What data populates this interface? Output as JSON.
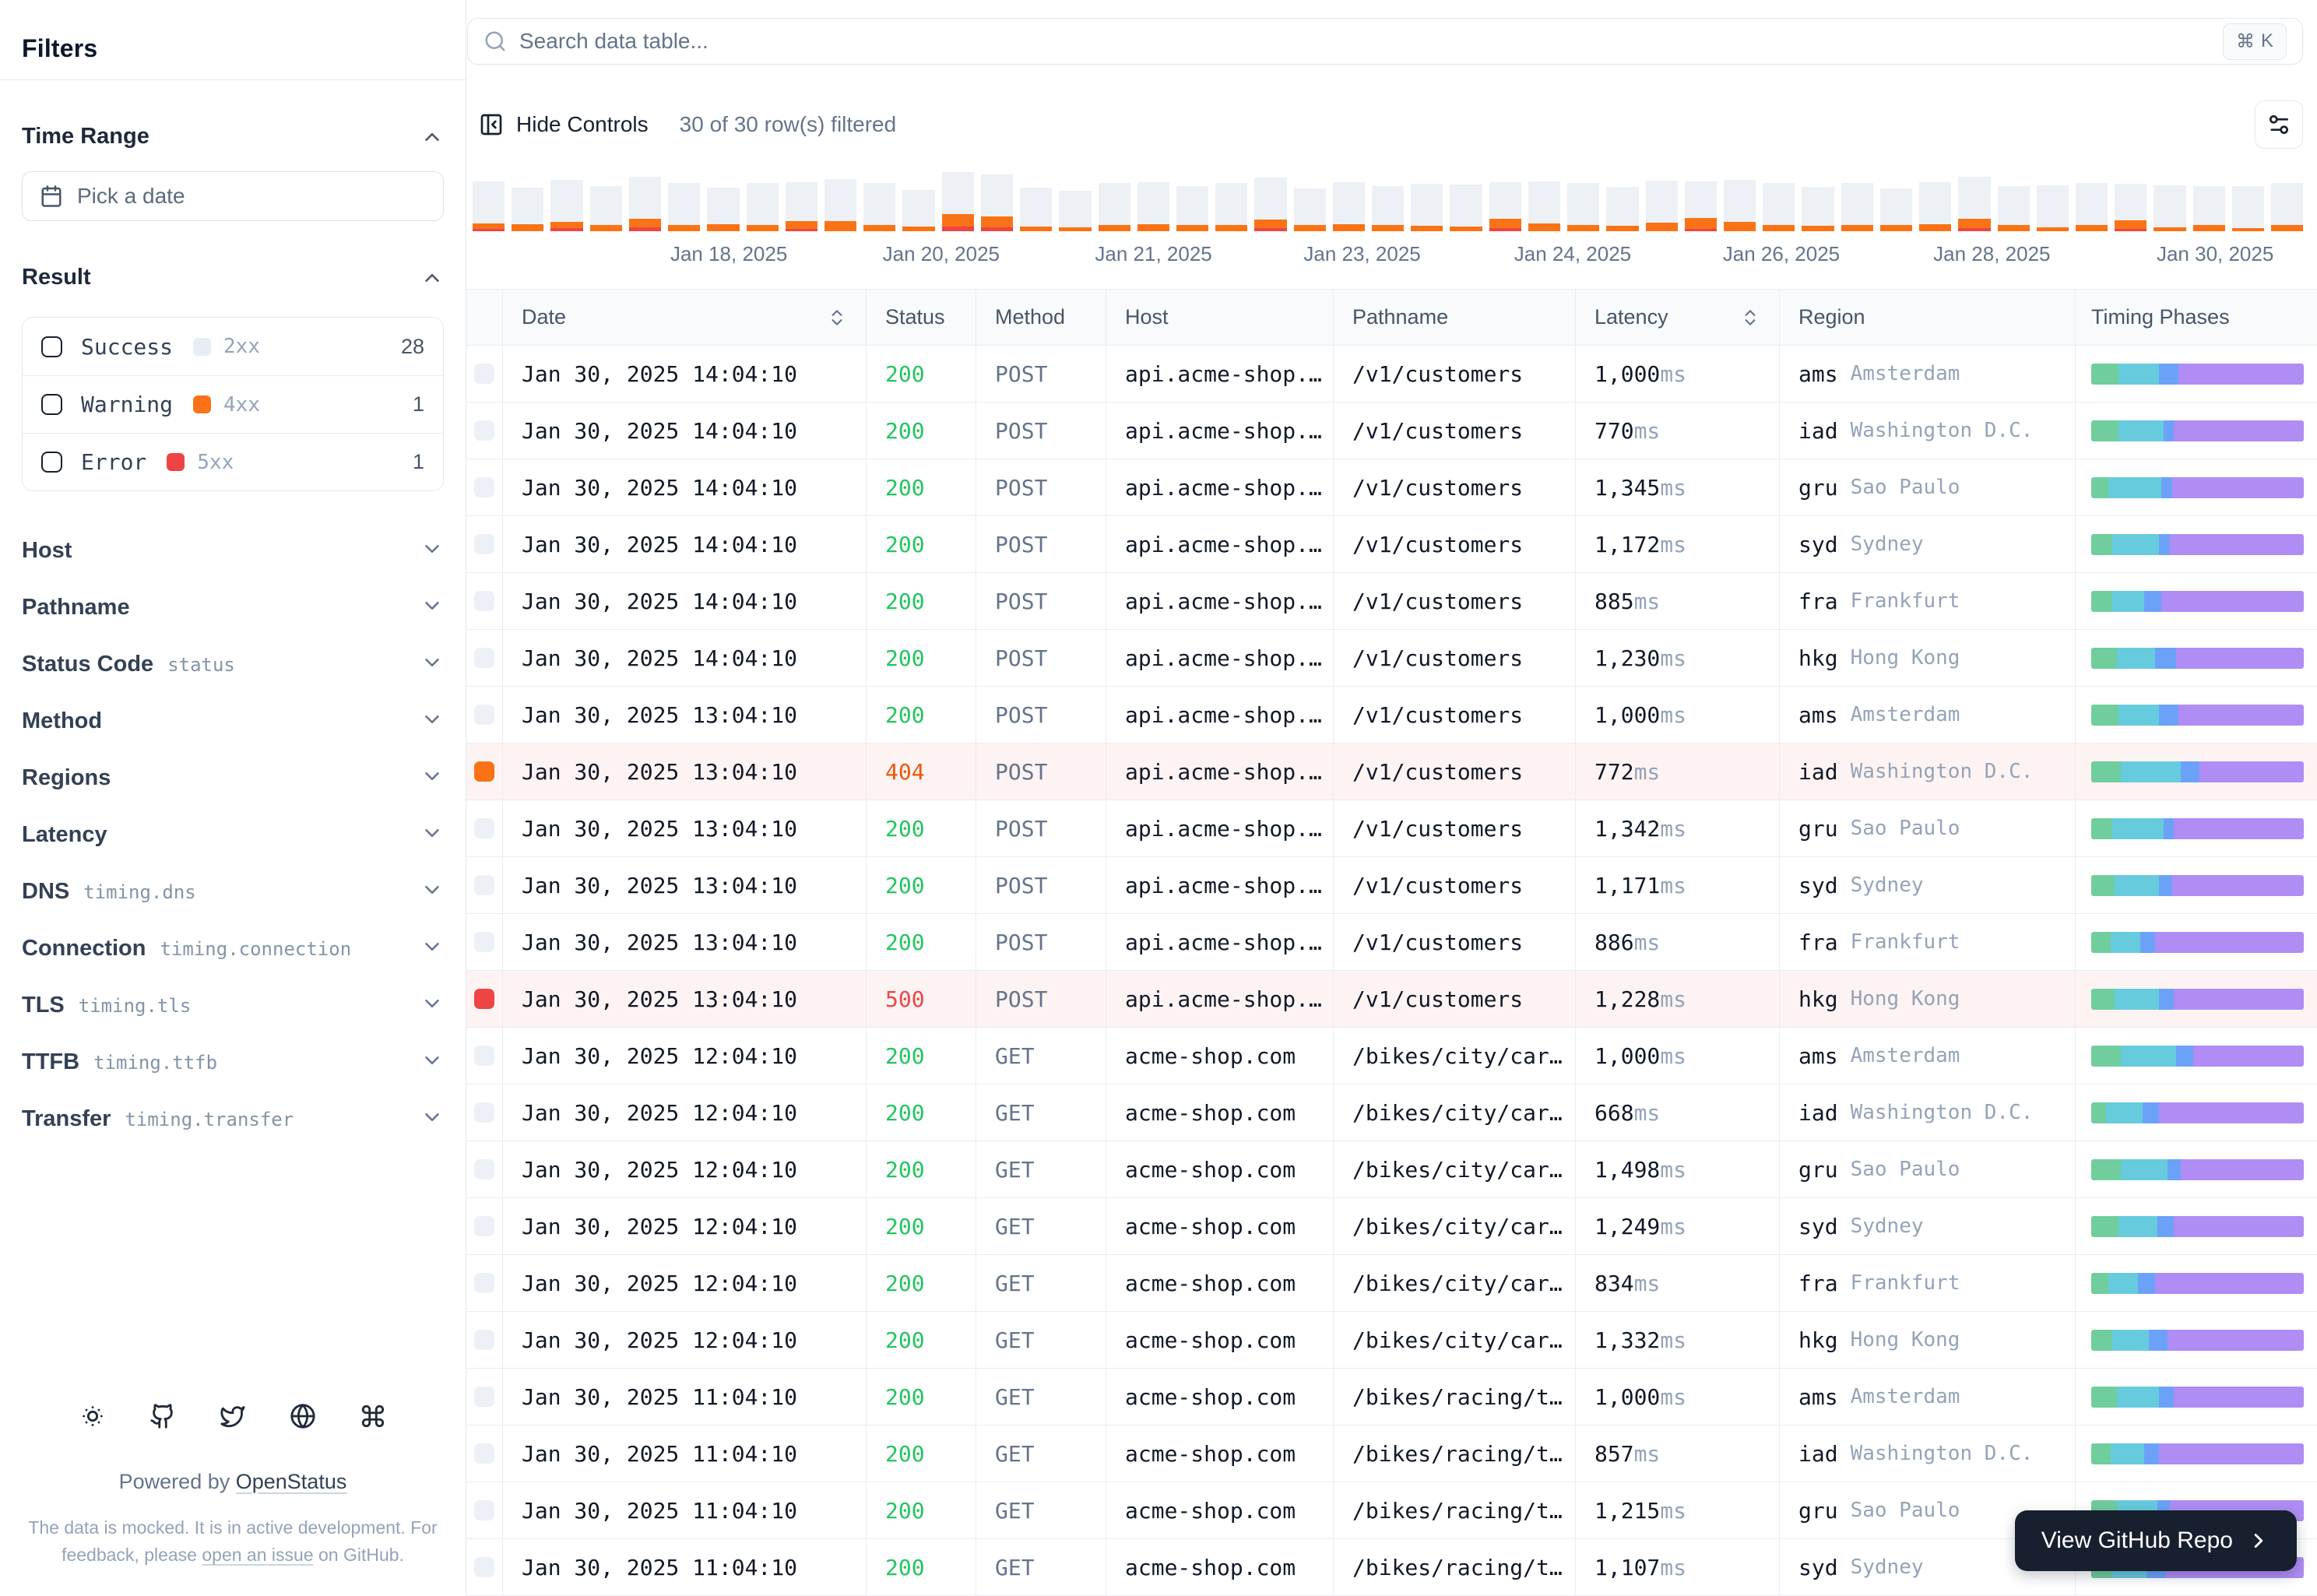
{
  "sidebar": {
    "title": "Filters",
    "time_range": {
      "label": "Time Range",
      "placeholder": "Pick a date"
    },
    "result": {
      "label": "Result",
      "items": [
        {
          "label": "Success",
          "code": "2xx",
          "count": "28",
          "chip_color": "#e7edf4"
        },
        {
          "label": "Warning",
          "code": "4xx",
          "count": "1",
          "chip_color": "#f97316"
        },
        {
          "label": "Error",
          "code": "5xx",
          "count": "1",
          "chip_color": "#ef4444"
        }
      ]
    },
    "sections": [
      {
        "label": "Host",
        "code": ""
      },
      {
        "label": "Pathname",
        "code": ""
      },
      {
        "label": "Status Code",
        "code": "status"
      },
      {
        "label": "Method",
        "code": ""
      },
      {
        "label": "Regions",
        "code": ""
      },
      {
        "label": "Latency",
        "code": ""
      },
      {
        "label": "DNS",
        "code": "timing.dns"
      },
      {
        "label": "Connection",
        "code": "timing.connection"
      },
      {
        "label": "TLS",
        "code": "timing.tls"
      },
      {
        "label": "TTFB",
        "code": "timing.ttfb"
      },
      {
        "label": "Transfer",
        "code": "timing.transfer"
      }
    ],
    "footer": {
      "icons": [
        "sun-icon",
        "github-icon",
        "twitter-icon",
        "globe-icon",
        "command-icon"
      ],
      "powered_prefix": "Powered by",
      "brand": "OpenStatus",
      "note_line1": "The data is mocked. It is in active development. For",
      "note_line2_pre": "feedback, please ",
      "note_line2_link": "open an issue",
      "note_line2_post": " on GitHub."
    }
  },
  "toolbar": {
    "search_placeholder": "Search data table...",
    "shortcut_cmd": "⌘",
    "shortcut_key": "K",
    "hide_controls_label": "Hide Controls",
    "filter_count": "30 of 30 row(s) filtered"
  },
  "chart_data": {
    "type": "bar",
    "stacked": true,
    "title": "Requests per time bucket (success vs error)",
    "xlabel": "",
    "ylabel": "",
    "grid": false,
    "x_tick_labels": [
      "Jan 18, 2025",
      "Jan 20, 2025",
      "Jan 21, 2025",
      "Jan 23, 2025",
      "Jan 24, 2025",
      "Jan 26, 2025",
      "Jan 28, 2025",
      "Jan 30, 2025"
    ],
    "x_tick_positions_pct": [
      14.0,
      25.6,
      37.2,
      48.6,
      60.1,
      71.5,
      83.0,
      95.2
    ],
    "series": [
      {
        "name": "success",
        "color": "#edf1f6",
        "values": [
          54,
          47,
          54,
          50,
          54,
          54,
          47,
          54,
          50,
          54,
          54,
          47,
          54,
          54,
          50,
          47,
          54,
          54,
          50,
          54,
          54,
          47,
          54,
          50,
          54,
          54,
          47,
          54,
          54,
          50,
          54,
          47,
          54,
          54,
          50,
          54,
          47,
          54,
          54,
          50,
          54,
          54,
          47,
          54,
          50,
          54,
          54
        ]
      },
      {
        "name": "error_4xx",
        "color": "#f97316",
        "values": [
          7,
          9,
          8,
          8,
          11,
          8,
          9,
          8,
          10,
          13,
          8,
          6,
          16,
          14,
          6,
          5,
          8,
          9,
          8,
          8,
          11,
          8,
          9,
          8,
          7,
          6,
          12,
          10,
          8,
          7,
          11,
          14,
          12,
          8,
          7,
          8,
          8,
          9,
          12,
          8,
          5,
          8,
          11,
          5,
          8,
          4,
          8
        ]
      },
      {
        "name": "error_5xx",
        "color": "#ef4444",
        "values": [
          3,
          0,
          4,
          0,
          5,
          0,
          0,
          0,
          3,
          0,
          0,
          0,
          6,
          5,
          0,
          0,
          0,
          0,
          0,
          0,
          4,
          0,
          0,
          0,
          0,
          0,
          4,
          0,
          0,
          0,
          0,
          3,
          0,
          0,
          0,
          0,
          0,
          0,
          4,
          0,
          0,
          0,
          3,
          0,
          0,
          0,
          0
        ]
      }
    ]
  },
  "table": {
    "columns": [
      {
        "label": "",
        "sortable": false
      },
      {
        "label": "Date",
        "sortable": true
      },
      {
        "label": "Status",
        "sortable": false
      },
      {
        "label": "Method",
        "sortable": false
      },
      {
        "label": "Host",
        "sortable": false
      },
      {
        "label": "Pathname",
        "sortable": false
      },
      {
        "label": "Latency",
        "sortable": true
      },
      {
        "label": "Region",
        "sortable": false
      },
      {
        "label": "Timing Phases",
        "sortable": false
      }
    ],
    "phase_colors": [
      "#70cd9d",
      "#67cbde",
      "#6ba2f8",
      "#af8df5"
    ],
    "rows": [
      {
        "date": "Jan 30, 2025 14:04:10",
        "status": "200",
        "status_type": "success",
        "method": "POST",
        "host": "api.acme-shop.…",
        "pathname": "/v1/customers",
        "latency": "1,000",
        "unit": "ms",
        "region_code": "ams",
        "region_city": "Amsterdam",
        "phases": [
          13,
          19,
          9,
          59
        ]
      },
      {
        "date": "Jan 30, 2025 14:04:10",
        "status": "200",
        "status_type": "success",
        "method": "POST",
        "host": "api.acme-shop.…",
        "pathname": "/v1/customers",
        "latency": "770",
        "unit": "ms",
        "region_code": "iad",
        "region_city": "Washington D.C.",
        "phases": [
          13,
          21,
          5,
          61
        ]
      },
      {
        "date": "Jan 30, 2025 14:04:10",
        "status": "200",
        "status_type": "success",
        "method": "POST",
        "host": "api.acme-shop.…",
        "pathname": "/v1/customers",
        "latency": "1,345",
        "unit": "ms",
        "region_code": "gru",
        "region_city": "Sao Paulo",
        "phases": [
          8,
          25,
          5,
          62
        ]
      },
      {
        "date": "Jan 30, 2025 14:04:10",
        "status": "200",
        "status_type": "success",
        "method": "POST",
        "host": "api.acme-shop.…",
        "pathname": "/v1/customers",
        "latency": "1,172",
        "unit": "ms",
        "region_code": "syd",
        "region_city": "Sydney",
        "phases": [
          10,
          22,
          5,
          63
        ]
      },
      {
        "date": "Jan 30, 2025 14:04:10",
        "status": "200",
        "status_type": "success",
        "method": "POST",
        "host": "api.acme-shop.…",
        "pathname": "/v1/customers",
        "latency": "885",
        "unit": "ms",
        "region_code": "fra",
        "region_city": "Frankfurt",
        "phases": [
          10,
          15,
          8,
          67
        ]
      },
      {
        "date": "Jan 30, 2025 14:04:10",
        "status": "200",
        "status_type": "success",
        "method": "POST",
        "host": "api.acme-shop.…",
        "pathname": "/v1/customers",
        "latency": "1,230",
        "unit": "ms",
        "region_code": "hkg",
        "region_city": "Hong Kong",
        "phases": [
          12,
          18,
          10,
          60
        ]
      },
      {
        "date": "Jan 30, 2025 13:04:10",
        "status": "200",
        "status_type": "success",
        "method": "POST",
        "host": "api.acme-shop.…",
        "pathname": "/v1/customers",
        "latency": "1,000",
        "unit": "ms",
        "region_code": "ams",
        "region_city": "Amsterdam",
        "phases": [
          13,
          19,
          9,
          59
        ]
      },
      {
        "date": "Jan 30, 2025 13:04:10",
        "status": "404",
        "status_type": "warning",
        "method": "POST",
        "host": "api.acme-shop.…",
        "pathname": "/v1/customers",
        "latency": "772",
        "unit": "ms",
        "region_code": "iad",
        "region_city": "Washington D.C.",
        "phases": [
          14,
          28,
          9,
          49
        ]
      },
      {
        "date": "Jan 30, 2025 13:04:10",
        "status": "200",
        "status_type": "success",
        "method": "POST",
        "host": "api.acme-shop.…",
        "pathname": "/v1/customers",
        "latency": "1,342",
        "unit": "ms",
        "region_code": "gru",
        "region_city": "Sao Paulo",
        "phases": [
          10,
          24,
          5,
          61
        ]
      },
      {
        "date": "Jan 30, 2025 13:04:10",
        "status": "200",
        "status_type": "success",
        "method": "POST",
        "host": "api.acme-shop.…",
        "pathname": "/v1/customers",
        "latency": "1,171",
        "unit": "ms",
        "region_code": "syd",
        "region_city": "Sydney",
        "phases": [
          11,
          21,
          6,
          62
        ]
      },
      {
        "date": "Jan 30, 2025 13:04:10",
        "status": "200",
        "status_type": "success",
        "method": "POST",
        "host": "api.acme-shop.…",
        "pathname": "/v1/customers",
        "latency": "886",
        "unit": "ms",
        "region_code": "fra",
        "region_city": "Frankfurt",
        "phases": [
          9,
          14,
          7,
          70
        ]
      },
      {
        "date": "Jan 30, 2025 13:04:10",
        "status": "500",
        "status_type": "error",
        "method": "POST",
        "host": "api.acme-shop.…",
        "pathname": "/v1/customers",
        "latency": "1,228",
        "unit": "ms",
        "region_code": "hkg",
        "region_city": "Hong Kong",
        "phases": [
          11,
          21,
          7,
          61
        ]
      },
      {
        "date": "Jan 30, 2025 12:04:10",
        "status": "200",
        "status_type": "success",
        "method": "GET",
        "host": "acme-shop.com",
        "pathname": "/bikes/city/car…",
        "latency": "1,000",
        "unit": "ms",
        "region_code": "ams",
        "region_city": "Amsterdam",
        "phases": [
          14,
          26,
          8,
          52
        ]
      },
      {
        "date": "Jan 30, 2025 12:04:10",
        "status": "200",
        "status_type": "success",
        "method": "GET",
        "host": "acme-shop.com",
        "pathname": "/bikes/city/car…",
        "latency": "668",
        "unit": "ms",
        "region_code": "iad",
        "region_city": "Washington D.C.",
        "phases": [
          7,
          17,
          8,
          68
        ]
      },
      {
        "date": "Jan 30, 2025 12:04:10",
        "status": "200",
        "status_type": "success",
        "method": "GET",
        "host": "acme-shop.com",
        "pathname": "/bikes/city/car…",
        "latency": "1,498",
        "unit": "ms",
        "region_code": "gru",
        "region_city": "Sao Paulo",
        "phases": [
          14,
          22,
          6,
          58
        ]
      },
      {
        "date": "Jan 30, 2025 12:04:10",
        "status": "200",
        "status_type": "success",
        "method": "GET",
        "host": "acme-shop.com",
        "pathname": "/bikes/city/car…",
        "latency": "1,249",
        "unit": "ms",
        "region_code": "syd",
        "region_city": "Sydney",
        "phases": [
          13,
          18,
          8,
          61
        ]
      },
      {
        "date": "Jan 30, 2025 12:04:10",
        "status": "200",
        "status_type": "success",
        "method": "GET",
        "host": "acme-shop.com",
        "pathname": "/bikes/city/car…",
        "latency": "834",
        "unit": "ms",
        "region_code": "fra",
        "region_city": "Frankfurt",
        "phases": [
          8,
          14,
          8,
          70
        ]
      },
      {
        "date": "Jan 30, 2025 12:04:10",
        "status": "200",
        "status_type": "success",
        "method": "GET",
        "host": "acme-shop.com",
        "pathname": "/bikes/city/car…",
        "latency": "1,332",
        "unit": "ms",
        "region_code": "hkg",
        "region_city": "Hong Kong",
        "phases": [
          10,
          17,
          9,
          64
        ]
      },
      {
        "date": "Jan 30, 2025 11:04:10",
        "status": "200",
        "status_type": "success",
        "method": "GET",
        "host": "acme-shop.com",
        "pathname": "/bikes/racing/t…",
        "latency": "1,000",
        "unit": "ms",
        "region_code": "ams",
        "region_city": "Amsterdam",
        "phases": [
          12,
          20,
          7,
          61
        ]
      },
      {
        "date": "Jan 30, 2025 11:04:10",
        "status": "200",
        "status_type": "success",
        "method": "GET",
        "host": "acme-shop.com",
        "pathname": "/bikes/racing/t…",
        "latency": "857",
        "unit": "ms",
        "region_code": "iad",
        "region_city": "Washington D.C.",
        "phases": [
          9,
          16,
          7,
          68
        ]
      },
      {
        "date": "Jan 30, 2025 11:04:10",
        "status": "200",
        "status_type": "success",
        "method": "GET",
        "host": "acme-shop.com",
        "pathname": "/bikes/racing/t…",
        "latency": "1,215",
        "unit": "ms",
        "region_code": "gru",
        "region_city": "Sao Paulo",
        "phases": [
          12,
          19,
          6,
          63
        ]
      },
      {
        "date": "Jan 30, 2025 11:04:10",
        "status": "200",
        "status_type": "success",
        "method": "GET",
        "host": "acme-shop.com",
        "pathname": "/bikes/racing/t…",
        "latency": "1,107",
        "unit": "ms",
        "region_code": "syd",
        "region_city": "Sydney",
        "phases": [
          10,
          16,
          9,
          65
        ]
      }
    ]
  },
  "github_button": {
    "label": "View GitHub Repo"
  },
  "colors": {
    "status_success": "#22c55e",
    "status_warning": "#ea580c",
    "status_error": "#ef4444",
    "indicator_default": "#edf1f7",
    "indicator_warning": "#f97316",
    "indicator_error": "#ef4444",
    "row_highlight_bg": "#fdf3f2"
  }
}
